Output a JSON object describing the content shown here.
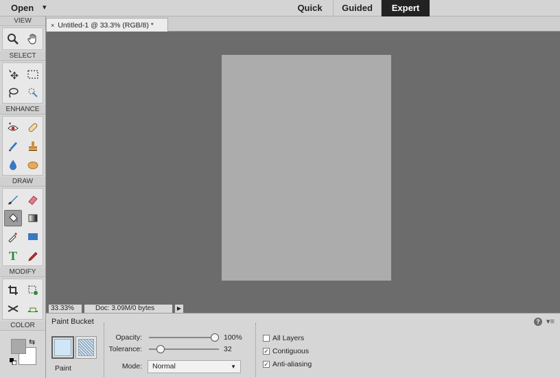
{
  "topbar": {
    "open_label": "Open",
    "open_arrow": "▾",
    "modes": [
      {
        "label": "Quick",
        "active": false
      },
      {
        "label": "Guided",
        "active": false
      },
      {
        "label": "Expert",
        "active": true
      }
    ]
  },
  "toolbox": {
    "sections": {
      "view": "VIEW",
      "select": "SELECT",
      "enhance": "ENHANCE",
      "draw": "DRAW",
      "modify": "MODIFY",
      "color": "COLOR"
    },
    "selected_tool": "paint-bucket-tool",
    "foreground_color": "#a9a9a9",
    "background_color": "#ffffff"
  },
  "document": {
    "tab_title": "Untitled-1 @ 33.3% (RGB/8) *",
    "close_glyph": "×",
    "canvas_color": "#acacac"
  },
  "status": {
    "zoom": "33.33%",
    "doc_info": "Doc: 3.09M/0 bytes",
    "menu_arrow": "▶"
  },
  "options": {
    "tool_name": "Paint Bucket",
    "help_glyph": "?",
    "panel_menu_glyph": "▾≡",
    "paint_label": "Paint",
    "opacity_label": "Opacity:",
    "opacity_value": "100%",
    "opacity_fraction": 1.0,
    "tolerance_label": "Tolerance:",
    "tolerance_value": "32",
    "tolerance_fraction": 0.125,
    "mode_label": "Mode:",
    "mode_value": "Normal",
    "checkboxes": [
      {
        "label": "All Layers",
        "checked": false
      },
      {
        "label": "Contiguous",
        "checked": true
      },
      {
        "label": "Anti-aliasing",
        "checked": true
      }
    ]
  }
}
